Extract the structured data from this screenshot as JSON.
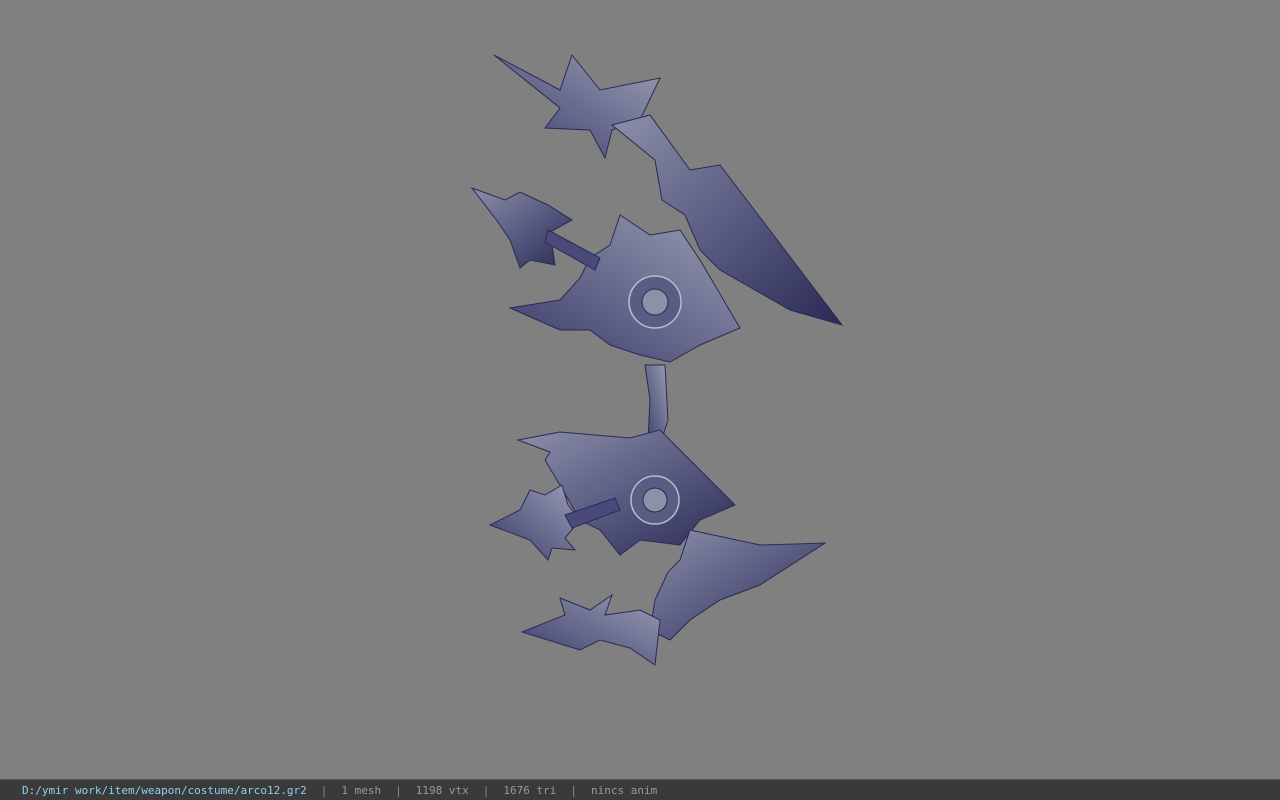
{
  "viewer": {
    "background_color": "#808080",
    "model_icon": "weapon-bow-model",
    "model_colors": {
      "dark": "#2a2a55",
      "mid": "#4a4a7a",
      "light": "#8c90a8",
      "edge": "#b8bccc"
    }
  },
  "status_bar": {
    "file_path": "D:/ymir work/item/weapon/costume/arco12.gr2",
    "separator": "|",
    "mesh_count": "1 mesh",
    "vertex_count": "1198 vtx",
    "triangle_count": "1676 tri",
    "anim_status": "nincs anim"
  }
}
